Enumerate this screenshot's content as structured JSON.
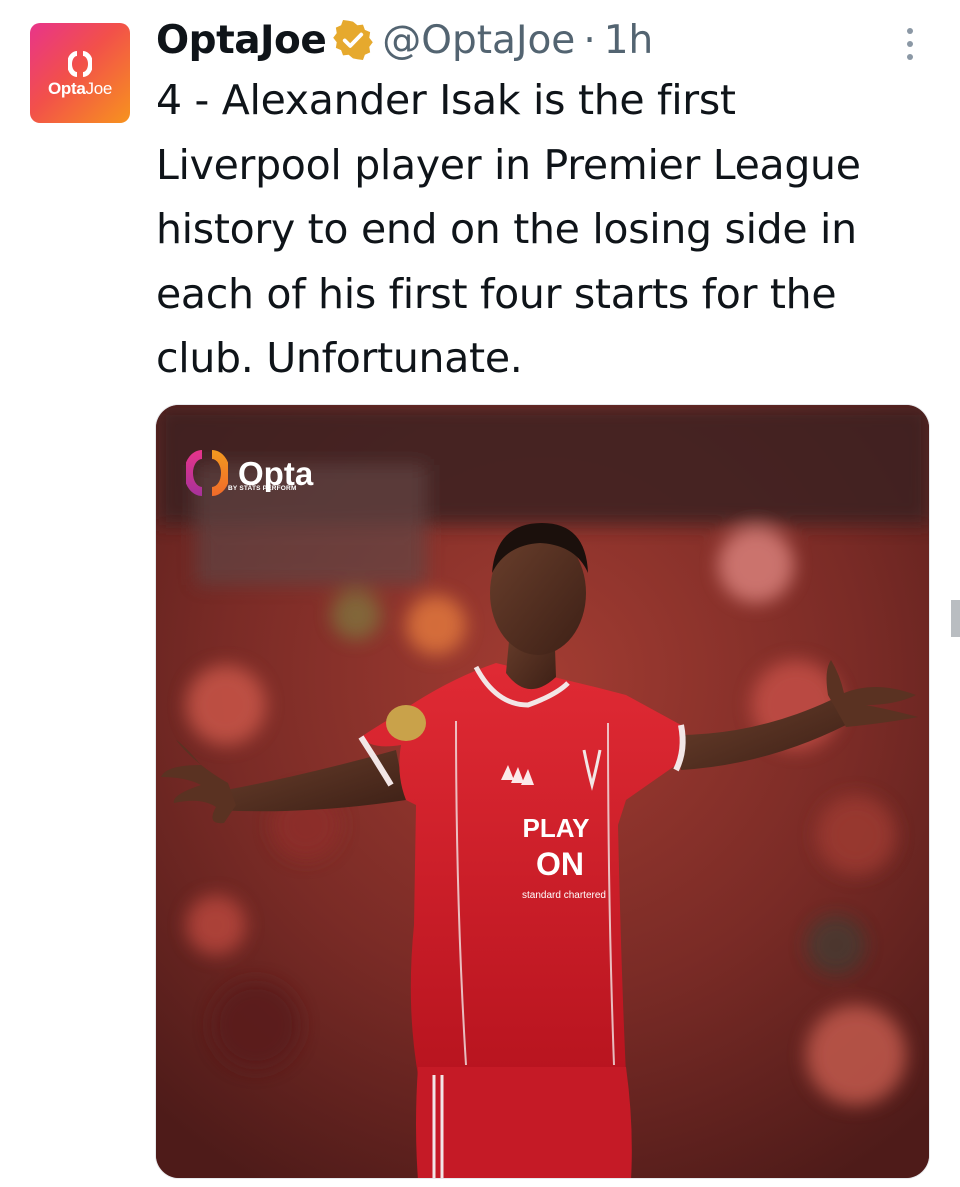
{
  "tweet": {
    "avatar": {
      "brand_bold": "Opta",
      "brand_light": "Joe"
    },
    "display_name": "OptaJoe",
    "handle": "@OptaJoe",
    "separator": "·",
    "time": "1h",
    "verified_color": "#e6a92d",
    "text": "4 - Alexander Isak is the first\nLiverpool player in Premier League\nhistory to end on the losing side in\neach of his first four starts for the\nclub. Unfortunate.",
    "more_icon": "more-vertical-icon"
  },
  "media": {
    "watermark": {
      "word": "Opta",
      "sub": "BY STATS PERFORM"
    },
    "shirt_text": {
      "line1": "PLAY",
      "line2": "ON",
      "sponsor": "standard chartered"
    },
    "colors": {
      "kit": "#d3202e",
      "crowd": "#7a2b26"
    }
  }
}
